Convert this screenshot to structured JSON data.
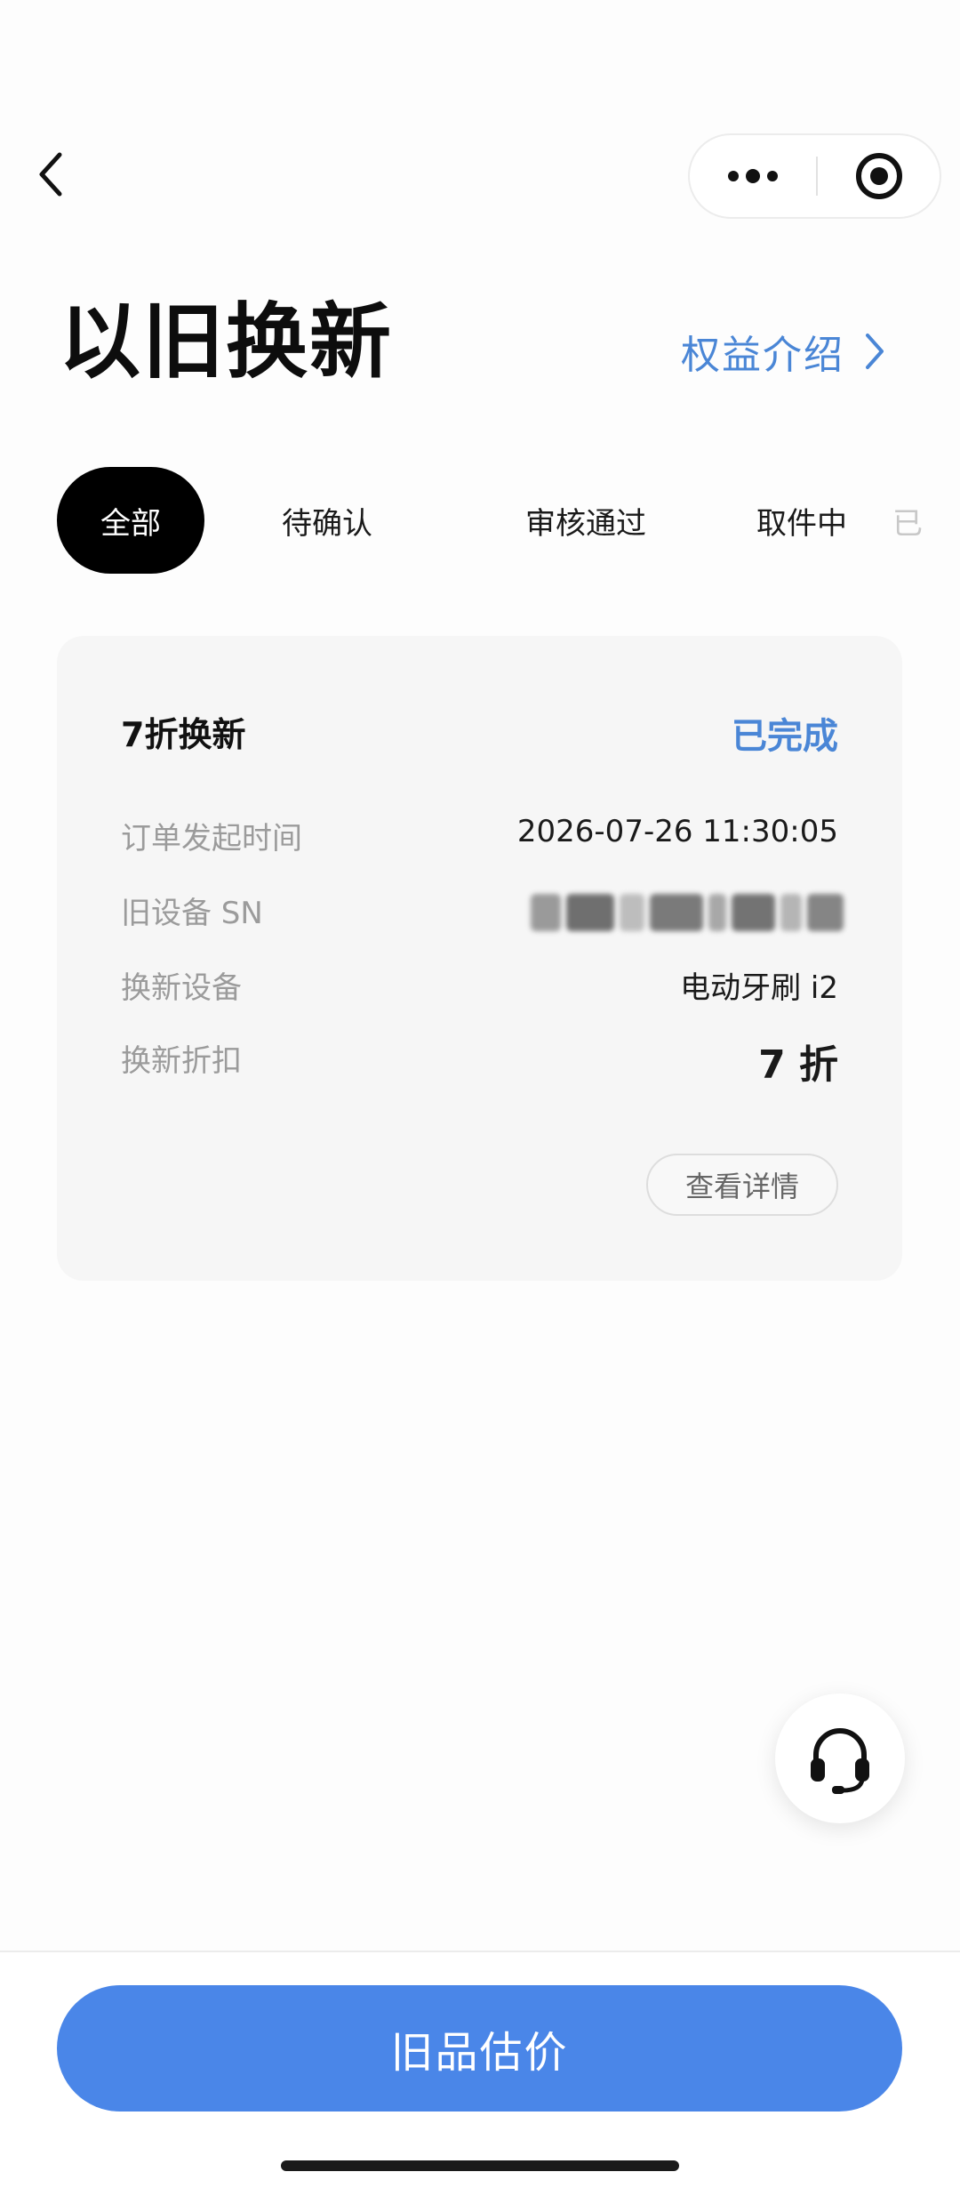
{
  "header": {
    "title": "以旧换新",
    "benefit_link": "权益介绍"
  },
  "tabs": [
    {
      "label": "全部",
      "active": true
    },
    {
      "label": "待确认",
      "active": false
    },
    {
      "label": "审核通过",
      "active": false
    },
    {
      "label": "取件中",
      "active": false
    },
    {
      "label": "已",
      "active": false
    }
  ],
  "order": {
    "title": "7折换新",
    "status": "已完成",
    "rows": [
      {
        "label": "订单发起时间",
        "value": "2026-07-26 11:30:05"
      },
      {
        "label": "旧设备 SN",
        "value": ""
      },
      {
        "label": "换新设备",
        "value": "电动牙刷 i2"
      },
      {
        "label": "换新折扣",
        "value": "7 折"
      }
    ],
    "detail_button": "查看详情"
  },
  "bottom": {
    "primary_button": "旧品估价"
  },
  "colors": {
    "accent": "#4a86d6",
    "primary_button": "#4a86e8",
    "active_tab": "#000000",
    "card_bg": "#f6f6f6"
  },
  "icons": [
    "back-chevron-icon",
    "more-dots-icon",
    "close-target-icon",
    "chevron-right-icon",
    "headset-icon"
  ]
}
